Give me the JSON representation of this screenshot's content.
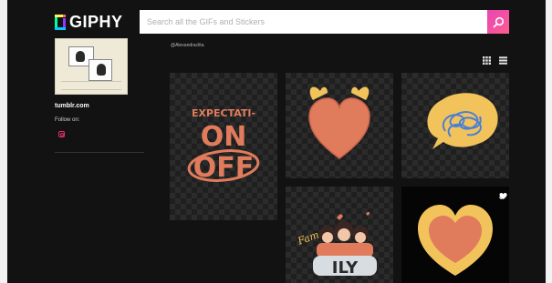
{
  "header": {
    "logo_text": "GIPHY",
    "search_placeholder": "Search all the GIFs and Stickers"
  },
  "sidebar": {
    "site": "tumblr.com",
    "follow_label": "Follow on:"
  },
  "main": {
    "username": "@Alexandraclita"
  },
  "stickers": {
    "expectation_text": [
      "EXPECTATI-",
      "ON",
      "OFF"
    ],
    "ily_text": "ILY",
    "fam_text": "Fam"
  },
  "colors": {
    "background": "#121212",
    "search_accent": "#e646b6",
    "sticker_orange": "#e07c5c",
    "sticker_yellow": "#f2c35b",
    "sticker_blue": "#4a7fd6"
  },
  "icons": {
    "search": "search-icon",
    "grid_view": "grid-view-icon",
    "list_view": "list-view-icon",
    "instagram": "instagram-icon",
    "link": "link-icon",
    "favorite": "heart-icon"
  }
}
